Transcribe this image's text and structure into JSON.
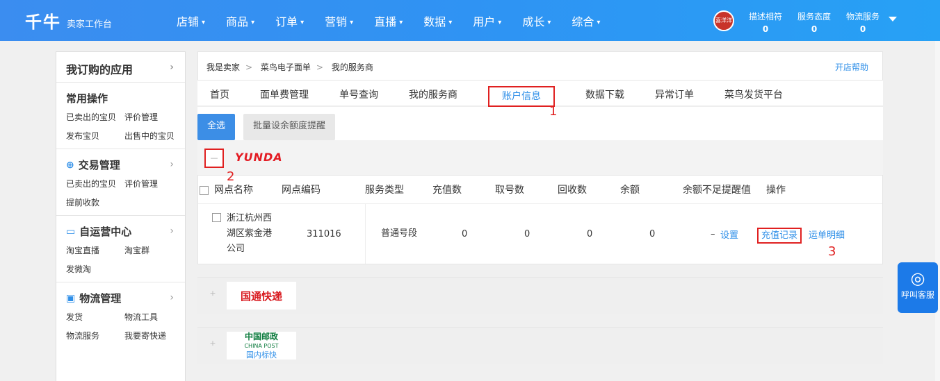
{
  "header": {
    "logo": "千牛",
    "subtitle": "卖家工作台",
    "nav": [
      "店铺",
      "商品",
      "订单",
      "营销",
      "直播",
      "数据",
      "用户",
      "成长",
      "综合"
    ],
    "avatar_text": "喜洋洋",
    "metrics": [
      {
        "label": "描述相符",
        "value": "0"
      },
      {
        "label": "服务态度",
        "value": "0"
      },
      {
        "label": "物流服务",
        "value": "0"
      }
    ]
  },
  "sidebar": {
    "head": "我订购的应用",
    "sections": [
      {
        "title": "常用操作",
        "links": [
          "已卖出的宝贝",
          "评价管理",
          "发布宝贝",
          "出售中的宝贝"
        ]
      },
      {
        "title": "交易管理",
        "links": [
          "已卖出的宝贝",
          "评价管理",
          "提前收款"
        ]
      },
      {
        "title": "自运营中心",
        "links": [
          "淘宝直播",
          "淘宝群",
          "发微淘"
        ]
      },
      {
        "title": "物流管理",
        "links": [
          "发货",
          "物流工具",
          "物流服务",
          "我要寄快递"
        ]
      }
    ]
  },
  "breadcrumb": [
    "我是卖家",
    "菜鸟电子面单",
    "我的服务商"
  ],
  "help": "开店帮助",
  "tabs": [
    "首页",
    "面单费管理",
    "单号查询",
    "我的服务商",
    "账户信息",
    "数据下载",
    "异常订单",
    "菜鸟发货平台"
  ],
  "annotations": [
    "1",
    "2",
    "3"
  ],
  "buttons": {
    "select_all": "全选",
    "batch": "批量设余额度提醒"
  },
  "yunda_logo": "YUNDA",
  "table": {
    "headers": [
      "网点名称",
      "网点编码",
      "服务类型",
      "充值数",
      "取号数",
      "回收数",
      "余额",
      "余额不足提醒值",
      "操作"
    ],
    "row": {
      "name": "浙江杭州西湖区紫金港公司",
      "code": "311016",
      "type": "普通号段",
      "recharge": "0",
      "taken": "0",
      "recycled": "0",
      "balance": "0",
      "alert": "–",
      "ops": [
        "设置",
        "充值记录",
        "运单明细"
      ]
    }
  },
  "carriers": {
    "sto": "国通快递",
    "post_cn": "中国邮政",
    "post_en": "CHINA POST",
    "post_sub": "国内标快"
  },
  "float_service": "呼叫客服"
}
